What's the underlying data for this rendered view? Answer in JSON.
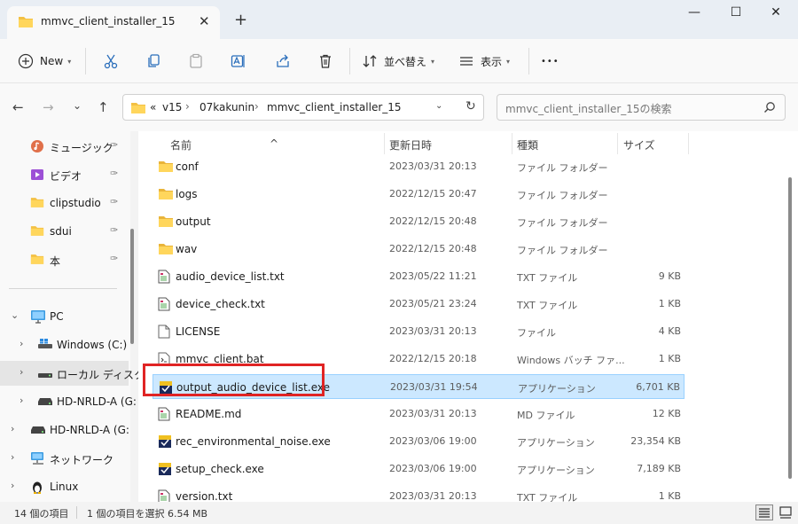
{
  "window": {
    "tab_title": "mmvc_client_installer_15",
    "tab_close": "✕",
    "new_tab": "+",
    "minimize": "—",
    "maximize": "☐",
    "close": "✕"
  },
  "toolbar": {
    "new_label": "New",
    "sort_label": "並べ替え",
    "view_label": "表示",
    "more_label": "•••"
  },
  "nav": {
    "back": "←",
    "forward": "→",
    "recent": "⌄",
    "up": "↑"
  },
  "address": {
    "overflow": "«",
    "crumbs": [
      "v15",
      "07kakunin",
      "mmvc_client_installer_15"
    ],
    "sep": "›",
    "dropdown": "⌄",
    "refresh": "↻"
  },
  "search": {
    "placeholder": "mmvc_client_installer_15の検索"
  },
  "sidebar": {
    "quick": [
      {
        "label": "ミュージック",
        "icon": "music-icon"
      },
      {
        "label": "ビデオ",
        "icon": "video-icon"
      },
      {
        "label": "clipstudio",
        "icon": "folder-icon"
      },
      {
        "label": "sdui",
        "icon": "folder-icon"
      },
      {
        "label": "本",
        "icon": "folder-icon"
      }
    ],
    "tree": [
      {
        "label": "PC",
        "icon": "pc-icon"
      },
      {
        "label": "Windows (C:)",
        "icon": "windows-drive-icon"
      },
      {
        "label": "ローカル ディスク",
        "icon": "drive-icon"
      },
      {
        "label": "HD-NRLD-A (G:",
        "icon": "external-drive-icon"
      },
      {
        "label": "HD-NRLD-A (G:",
        "icon": "external-drive-icon"
      },
      {
        "label": "ネットワーク",
        "icon": "network-icon"
      },
      {
        "label": "Linux",
        "icon": "linux-icon"
      }
    ],
    "pin": "📌",
    "expand": "›",
    "collapse": "⌄"
  },
  "columns": {
    "name": "名前",
    "date": "更新日時",
    "type": "種類",
    "size": "サイズ",
    "sort_arrow": "^"
  },
  "files": [
    {
      "name": "conf",
      "date": "2023/03/31 20:13",
      "type": "ファイル フォルダー",
      "size": "",
      "icon": "folder-icon"
    },
    {
      "name": "logs",
      "date": "2022/12/15 20:47",
      "type": "ファイル フォルダー",
      "size": "",
      "icon": "folder-icon"
    },
    {
      "name": "output",
      "date": "2022/12/15 20:48",
      "type": "ファイル フォルダー",
      "size": "",
      "icon": "folder-icon"
    },
    {
      "name": "wav",
      "date": "2022/12/15 20:48",
      "type": "ファイル フォルダー",
      "size": "",
      "icon": "folder-icon"
    },
    {
      "name": "audio_device_list.txt",
      "date": "2023/05/22 11:21",
      "type": "TXT ファイル",
      "size": "9 KB",
      "icon": "text-file-icon"
    },
    {
      "name": "device_check.txt",
      "date": "2023/05/21 23:24",
      "type": "TXT ファイル",
      "size": "1 KB",
      "icon": "text-file-icon"
    },
    {
      "name": "LICENSE",
      "date": "2023/03/31 20:13",
      "type": "ファイル",
      "size": "4 KB",
      "icon": "file-icon"
    },
    {
      "name": "mmvc_client.bat",
      "date": "2022/12/15 20:18",
      "type": "Windows バッチ ファ...",
      "size": "1 KB",
      "icon": "batch-file-icon"
    },
    {
      "name": "output_audio_device_list.exe",
      "date": "2023/03/31 19:54",
      "type": "アプリケーション",
      "size": "6,701 KB",
      "icon": "exe-icon",
      "selected": true
    },
    {
      "name": "README.md",
      "date": "2023/03/31 20:13",
      "type": "MD ファイル",
      "size": "12 KB",
      "icon": "text-file-icon"
    },
    {
      "name": "rec_environmental_noise.exe",
      "date": "2023/03/06 19:00",
      "type": "アプリケーション",
      "size": "23,354 KB",
      "icon": "exe-icon"
    },
    {
      "name": "setup_check.exe",
      "date": "2023/03/06 19:00",
      "type": "アプリケーション",
      "size": "7,189 KB",
      "icon": "exe-icon"
    },
    {
      "name": "version.txt",
      "date": "2023/03/31 20:13",
      "type": "TXT ファイル",
      "size": "1 KB",
      "icon": "text-file-icon"
    }
  ],
  "status": {
    "count": "14 個の項目",
    "selection": "1 個の項目を選択  6.54 MB"
  },
  "colors": {
    "selected_row": "#cce8ff",
    "highlight": "#e02424",
    "folder": "#f3c043"
  }
}
